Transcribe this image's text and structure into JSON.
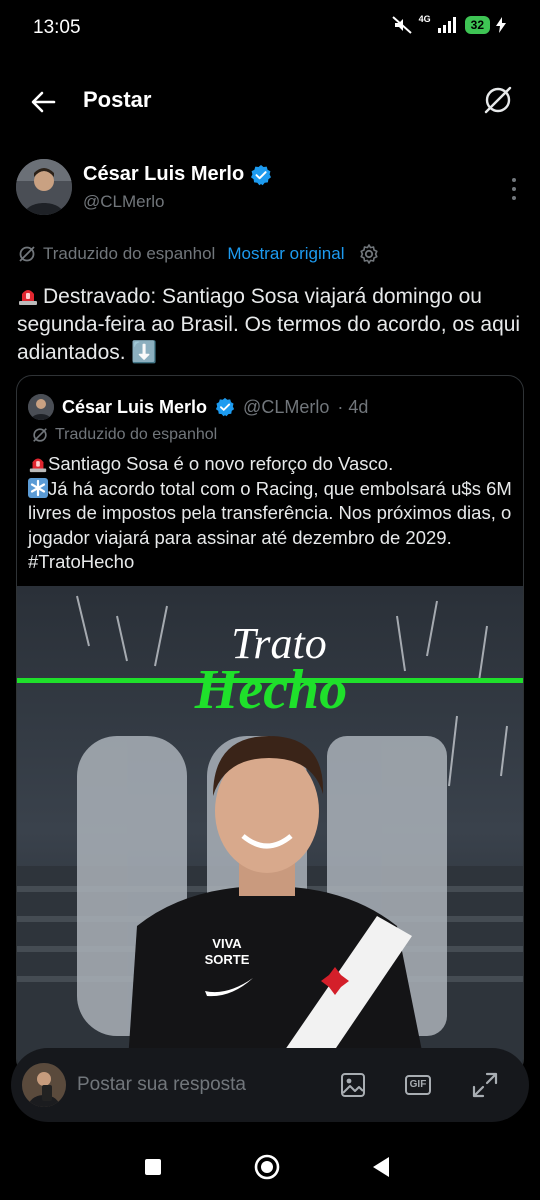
{
  "status_bar": {
    "time": "13:05",
    "network": "4G",
    "battery": "32"
  },
  "header": {
    "title": "Postar",
    "back_icon": "arrow-left-icon",
    "action_icon": "grok-icon"
  },
  "post": {
    "author_name": "César Luis Merlo",
    "author_handle": "@CLMerlo",
    "verified": true,
    "translated_label": "Traduzido do espanhol",
    "show_original": "Mostrar original",
    "text": "Destravado: Santiago Sosa viajará domingo ou segunda-feira ao Brasil. Os termos do acordo, os aqui adiantados. ⬇️"
  },
  "quote": {
    "author_name": "César Luis Merlo",
    "author_handle": "@CLMerlo",
    "time": "· 4d",
    "translated_label": "Traduzido do espanhol",
    "line1": "Santiago Sosa é o novo reforço do Vasco.",
    "line2": "Já há acordo total com o Racing, que embolsará u$s 6M livres de impostos pela transferência. Nos próximos dias, o jogador viajará para assinar até dezembro de 2029. #TratoHecho",
    "image": {
      "headline_1": "Trato",
      "headline_2": "Hecho",
      "sponsor_1": "VIVA",
      "sponsor_2": "SORTE"
    }
  },
  "reply": {
    "placeholder": "Postar sua resposta",
    "gif_label": "GIF"
  },
  "colors": {
    "accent": "#1d9bf0",
    "green": "#1fe02b"
  }
}
